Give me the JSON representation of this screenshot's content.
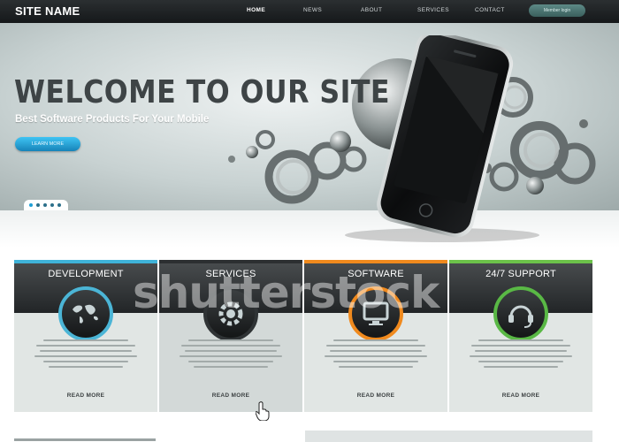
{
  "site_name": "SITE NAME",
  "nav": {
    "items": [
      {
        "label": "HOME",
        "active": true
      },
      {
        "label": "NEWS",
        "active": false
      },
      {
        "label": "ABOUT",
        "active": false
      },
      {
        "label": "SERVICES",
        "active": false
      },
      {
        "label": "CONTACT",
        "active": false
      }
    ],
    "member_button": "Member login"
  },
  "hero": {
    "title": "WELCOME TO OUR SITE",
    "subtitle": "Best Software Products For Your Mobile",
    "button": "LEARN MORE",
    "slides": 5,
    "active_slide": 1
  },
  "panels": [
    {
      "title": "DEVELOPMENT",
      "icon": "world-map-icon",
      "accent": "#3fb3d9",
      "ring": "#4bb5d6",
      "read_more": "READ MORE"
    },
    {
      "title": "SERVICES",
      "icon": "gear-icon",
      "accent": "#2c2f31",
      "ring": "#2f3335",
      "read_more": "READ MORE"
    },
    {
      "title": "SOFTWARE",
      "icon": "monitor-icon",
      "accent": "#f08a1e",
      "ring": "#f08a1e",
      "read_more": "READ MORE"
    },
    {
      "title": "24/7 SUPPORT",
      "icon": "headset-icon",
      "accent": "#6cc24a",
      "ring": "#59b845",
      "read_more": "READ MORE"
    }
  ],
  "watermark": "shutterstock",
  "colors": {
    "nav_bg": "#1e2224",
    "accent_blue": "#1e9fd6",
    "panel_bg": "#e1e6e4"
  }
}
